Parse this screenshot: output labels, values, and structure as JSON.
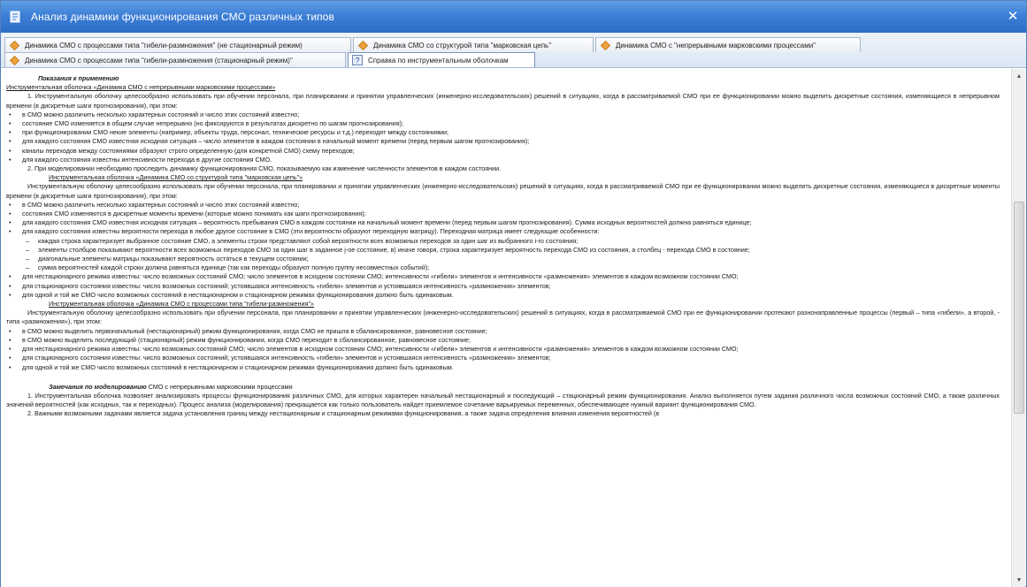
{
  "window": {
    "title": "Анализ динамики функционирования СМО различных типов",
    "close_glyph": "✕"
  },
  "tabs": [
    {
      "label": "Динамика СМО с процессами типа \"гибели-размножения\" (не стационарный режим)",
      "icon": "diamond-icon",
      "active": false
    },
    {
      "label": "Динамика СМО со структурой типа \"марковская цепь\"",
      "icon": "diamond-icon",
      "active": false
    },
    {
      "label": "Динамика СМО с \"непрерывными марковскими процессами\"",
      "icon": "diamond-icon",
      "active": false
    },
    {
      "label": "Динамика СМО с процессами типа \"гибели-размножения (стационарный режим)\"",
      "icon": "diamond-icon",
      "active": false
    },
    {
      "label": "Справка по инструментальным оболочкам",
      "icon": "help-icon",
      "active": true
    }
  ],
  "content": {
    "h_usage": "Показания к применению",
    "s1_link": "Инструментальная оболочка «Динамика СМО с непрерывными марковскими процессами»",
    "s1_p1": "1. Инструментальную оболочку целесообразно использовать при обучении персонала, при планировании и принятии управленческих (инженерно-исследовательских) решений в ситуациях, когда в рассматриваемой СМО при ее функционировании можно выделить дискретные состояния, изменяющиеся в непрерывном времени (в дискретные шаги прогнозирования), при этом:",
    "s1_bullets": [
      "в СМО можно различить несколько характерных состояний и число этих состояний известно;",
      "состояние СМО изменяется в общем случае непрерывно (но фиксируются в результатах дискретно по шагам прогнозирования);",
      "при функционировании СМО некие элементы (например, объекты труда, персонал, технические ресурсы и т.д.) переходят между состояниями;",
      "для каждого состояния СМО известная исходная ситуация – число элементов в каждом состоянии в начальный момент времени (перед первым шагом прогнозирования);",
      "каналы переходов между состояниями образуют строго определенную (для конкретной СМО) схему переходов;",
      "для каждого состояния известны интенсивности перехода в другие состояния СМО."
    ],
    "s1_p2": "2. При моделировании необходимо проследить динамику функционирования СМО, показываемую как изменение численности элементов в каждом состоянии.",
    "s2_link": "Инструментальная оболочка «Динамика СМО со структурой типа \"марковская цепь\"»",
    "s2_p1": "Инструментальную оболочку целесообразно использовать при обучении персонала, при планировании и принятии управленческих (инженерно-исследовательских) решений в ситуациях, когда в рассматриваемой СМО при ее функционировании можно выделить дискретные состояния, изменяющиеся в дискретные моменты времени (в дискретные шаги прогнозирования), при этом:",
    "s2_bullets": [
      "в СМО можно различить несколько характерных состояний и число этих состояний известно;",
      "состояния СМО изменяются в дискретные моменты времени (которые можно понимать как шаги прогнозирования);",
      "для каждого состояния СМО известная исходная ситуация – вероятность пребывания СМО в каждом состоянии на начальный момент времени (перед первым шагом прогнозирования). Сумма исходных вероятностей должна равняться единице;",
      "для каждого состояния известны вероятности перехода в любое другое состояние в СМО (эти вероятности образуют переходную матрицу). Переходная матрица имеет следующие особенности:"
    ],
    "s2_dashes": [
      "каждая строка характеризует выбранное состояние СМО, а элементы строки представляют собой вероятности всех возможных переходов за один шаг из выбранного i-го состояния;",
      "элементы столбцов показывают вероятности всех возможных переходов СМО за один шаг в заданное j-ое состояние, в) иначе говоря, строка характеризует вероятность перехода СМО из состояния, а столбец - перехода СМО в состояние;",
      "диагональные элементы матрицы показывают вероятность остаться в текущем состоянии;",
      "сумма вероятностей каждой строки должна равняться единице (так как переходы образуют полную группу несовместных событий);"
    ],
    "s2_bullets2": [
      "для нестационарного режима известны: число возможных состояний СМО; число элементов в исходном состоянии СМО; интенсивности «гибели» элементов и интенсивности «размножения» элементов в каждом возможном состоянии СМО;",
      "для стационарного состояния известны: число возможных состояний; устоявшаяся интенсивность «гибели» элементов и устоявшаяся интенсивность «размножения» элементов;",
      "для одной и той же СМО число возможных состояний в нестационарном и стационарном режимах функционирования должно быть одинаковым."
    ],
    "s3_link": "Инструментальная оболочка «Динамика СМО с процессами типа \"гибели-размножения\"»",
    "s3_p1": "Инструментальную оболочку целесообразно использовать при обучении персонала, при планировании и принятии управленческих (инженерно-исследовательских) решений в ситуациях, когда в рассматриваемой СМО при ее функционировании протекают разнонаправленные процессы (первый – типа «гибели», а второй, - типа «размножения»), при этом:",
    "s3_bullets": [
      "в СМО можно выделить первоначальный (нестационарный) режим функционирования, когда СМО не пришла в сбалансированное, равновесное состояние;",
      "в СМО можно выделить последующий (стационарный) режим функционирования, когда СМО переходит в сбалансированное, равновесное состояние;",
      "для нестационарного режима известны: число возможных состояний СМО; число элементов в исходном состоянии СМО; интенсивности «гибели» элементов и интенсивности «размножения» элементов в каждом возможном состоянии СМО;",
      "для стационарного состояния известны: число возможных состояний; устоявшаяся интенсивность «гибели» элементов и устоявшаяся интенсивность «размножения» элементов;",
      "для одной и той же СМО число возможных состояний в нестационарном и стационарном режимах функционирования должно быть одинаковым."
    ],
    "h_notes_bold": "Замечания по моделированию",
    "h_notes_rest": " СМО с непрерывными марковскими процессами",
    "n_p1": "1. Инструментальная оболочка позволяет анализировать процессы функционирования различных СМО, для которых характерен начальный нестационарный и последующий – стационарный режим функционирования. Анализ выполняется путем задания различного числа возможных состояний СМО, а также различных значений вероятностей (как исходных, так и переходных). Процесс анализа (моделирования) прекращается как только пользователь найдет приемлемое сочетание варьируемых переменных, обеспечивающее нужный вариант функционирования СМО.",
    "n_p2": "2. Важными возможными задачами является задача установления границ между нестационарным и стационарным режимами функционирования, а также задача определения влияния изменения вероятностей (в"
  },
  "scrollbar": {
    "up_glyph": "▲",
    "down_glyph": "▼"
  }
}
